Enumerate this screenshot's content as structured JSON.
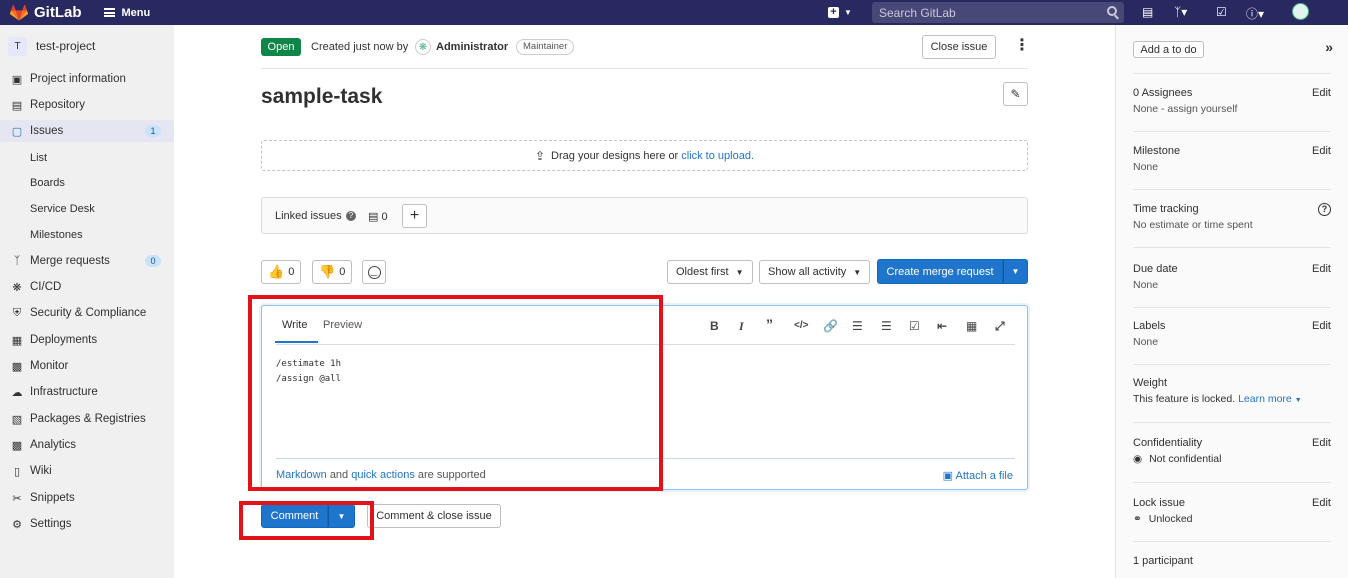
{
  "topbar": {
    "brand": "GitLab",
    "menu_label": "Menu",
    "search_placeholder": "Search GitLab"
  },
  "sidebar": {
    "project_initial": "T",
    "project_name": "test-project",
    "items": [
      {
        "label": "Project information",
        "icon": "info-icon"
      },
      {
        "label": "Repository",
        "icon": "document-icon"
      },
      {
        "label": "Issues",
        "icon": "issues-icon",
        "count": "1"
      },
      {
        "label": "Merge requests",
        "icon": "merge-request-icon",
        "count": "0"
      },
      {
        "label": "CI/CD",
        "icon": "rocket-icon"
      },
      {
        "label": "Security & Compliance",
        "icon": "shield-icon"
      },
      {
        "label": "Deployments",
        "icon": "deployments-icon"
      },
      {
        "label": "Monitor",
        "icon": "monitor-icon"
      },
      {
        "label": "Infrastructure",
        "icon": "cloud-icon"
      },
      {
        "label": "Packages & Registries",
        "icon": "package-icon"
      },
      {
        "label": "Analytics",
        "icon": "chart-icon"
      },
      {
        "label": "Wiki",
        "icon": "book-icon"
      },
      {
        "label": "Snippets",
        "icon": "scissors-icon"
      },
      {
        "label": "Settings",
        "icon": "gear-icon"
      }
    ],
    "issues_sub": [
      "List",
      "Boards",
      "Service Desk",
      "Milestones"
    ]
  },
  "issue": {
    "status": "Open",
    "created_text": "Created just now by",
    "author": "Administrator",
    "role": "Maintainer",
    "close_button": "Close issue",
    "title": "sample-task",
    "dropzone_text": "Drag your designs here or",
    "dropzone_link": "click to upload.",
    "linked_issues_label": "Linked issues",
    "linked_count": "0",
    "thumbs_up_count": "0",
    "thumbs_down_count": "0",
    "sort_label": "Oldest first",
    "filter_label": "Show all activity",
    "create_mr_label": "Create merge request"
  },
  "editor": {
    "tab_write": "Write",
    "tab_preview": "Preview",
    "content_line1": "/estimate 1h",
    "content_line2": "/assign @all",
    "footer_markdown": "Markdown",
    "footer_and": "and",
    "footer_quick_actions": "quick actions",
    "footer_supported": "are supported",
    "attach_label": "Attach a file",
    "comment_button": "Comment",
    "comment_close_button": "Comment & close issue"
  },
  "right_panel": {
    "todo_button": "Add a to do",
    "assignees_label": "0 Assignees",
    "assignees_value": "None - assign yourself",
    "milestone_label": "Milestone",
    "milestone_value": "None",
    "time_tracking_label": "Time tracking",
    "time_tracking_value": "No estimate or time spent",
    "due_date_label": "Due date",
    "due_date_value": "None",
    "labels_label": "Labels",
    "labels_value": "None",
    "weight_label": "Weight",
    "weight_value": "This feature is locked.",
    "weight_link": "Learn more",
    "confidentiality_label": "Confidentiality",
    "confidentiality_value": "Not confidential",
    "lock_label": "Lock issue",
    "lock_value": "Unlocked",
    "participants_label": "1 participant",
    "edit_label": "Edit"
  },
  "colors": {
    "topbar": "#292961",
    "primary": "#1f75cb",
    "open_badge": "#108548",
    "highlight": "#e2121b"
  }
}
